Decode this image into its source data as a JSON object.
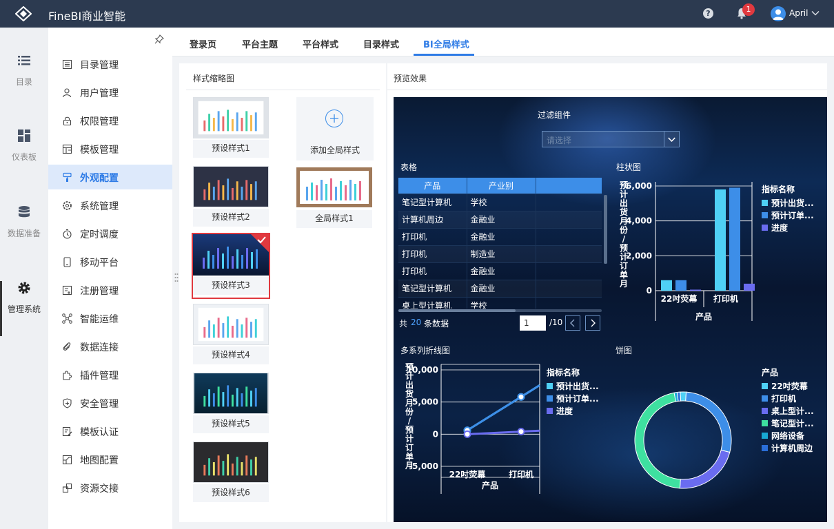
{
  "app": {
    "title": "FineBI商业智能",
    "user": "April",
    "notifications": "1",
    "help": "?"
  },
  "left_nav": [
    {
      "label": "目录",
      "icon": "list-icon"
    },
    {
      "label": "仪表板",
      "icon": "dashboard-icon"
    },
    {
      "label": "数据准备",
      "icon": "database-icon"
    },
    {
      "label": "管理系统",
      "icon": "gear-icon",
      "active": true
    }
  ],
  "side_menu": [
    {
      "label": "目录管理",
      "icon": "catalog-icon"
    },
    {
      "label": "用户管理",
      "icon": "user-icon"
    },
    {
      "label": "权限管理",
      "icon": "lock-icon"
    },
    {
      "label": "模板管理",
      "icon": "template-icon"
    },
    {
      "label": "外观配置",
      "icon": "brush-icon",
      "active": true
    },
    {
      "label": "系统管理",
      "icon": "settings-icon"
    },
    {
      "label": "定时调度",
      "icon": "timer-icon"
    },
    {
      "label": "移动平台",
      "icon": "mobile-icon"
    },
    {
      "label": "注册管理",
      "icon": "register-icon"
    },
    {
      "label": "智能运维",
      "icon": "ops-icon"
    },
    {
      "label": "数据连接",
      "icon": "link-icon"
    },
    {
      "label": "插件管理",
      "icon": "plugin-icon"
    },
    {
      "label": "安全管理",
      "icon": "shield-icon"
    },
    {
      "label": "模板认证",
      "icon": "certify-icon"
    },
    {
      "label": "地图配置",
      "icon": "map-icon"
    },
    {
      "label": "资源交接",
      "icon": "handover-icon"
    }
  ],
  "tabs": [
    {
      "label": "登录页"
    },
    {
      "label": "平台主题"
    },
    {
      "label": "平台样式"
    },
    {
      "label": "目录样式"
    },
    {
      "label": "BI全局样式",
      "active": true
    }
  ],
  "thumbnails": {
    "title": "样式缩略图",
    "add_label": "添加全局样式",
    "items": [
      {
        "label": "预设样式1"
      },
      {
        "label": "预设样式2"
      },
      {
        "label": "预设样式3",
        "selected": true
      },
      {
        "label": "预设样式4"
      },
      {
        "label": "预设样式5"
      },
      {
        "label": "预设样式6"
      },
      {
        "label": "全局样式1"
      }
    ]
  },
  "preview": {
    "title": "预览效果",
    "filter": {
      "title": "过滤组件",
      "placeholder": "请选择"
    },
    "table": {
      "title": "表格",
      "headers": [
        "产品",
        "产业别"
      ],
      "rows": [
        [
          "笔记型计算机",
          "学校"
        ],
        [
          "计算机周边",
          "金融业"
        ],
        [
          "打印机",
          "金融业"
        ],
        [
          "打印机",
          "制造业"
        ],
        [
          "打印机",
          "金融业"
        ],
        [
          "笔记型计算机",
          "金融业"
        ],
        [
          "桌上型计算机",
          "学校"
        ]
      ],
      "pager": {
        "prefix": "共",
        "count": "20",
        "suffix": "条数据",
        "page": "1",
        "total": "/10"
      }
    },
    "colors": {
      "cyan": "#4fd0f5",
      "blue": "#3d8ee8",
      "indigo": "#6a6cf0",
      "green": "#3ee0a0",
      "teal": "#18a9d4",
      "royal": "#2a6ed8"
    }
  },
  "chart_data": [
    {
      "type": "bar",
      "title": "柱状图",
      "xlabel": "产品",
      "ylabel": "预计出货月份/预计订单月份",
      "categories": [
        "22吋荧幕",
        "打印机"
      ],
      "legend_title": "指标名称",
      "legend_position": "right",
      "ylim": [
        0,
        6000
      ],
      "ticks": [
        "6,000",
        "4,000",
        "2,000",
        "0"
      ],
      "series": [
        {
          "name": "预计出货...",
          "color": "#4fd0f5",
          "values": [
            600,
            5800
          ]
        },
        {
          "name": "预计订单...",
          "color": "#3d8ee8",
          "values": [
            600,
            5900
          ]
        },
        {
          "name": "进度",
          "color": "#6a6cf0",
          "values": [
            20,
            400
          ]
        }
      ]
    },
    {
      "type": "line",
      "title": "多系列折线图",
      "xlabel": "产品",
      "ylabel": "预计出货月份/预计订单月份",
      "categories": [
        "22吋荧幕",
        "打印机"
      ],
      "legend_title": "指标名称",
      "legend_position": "right",
      "ylim": [
        -5000,
        10000
      ],
      "ticks": [
        "10,000",
        "5,000",
        "0",
        "-5,000"
      ],
      "series": [
        {
          "name": "预计出货...",
          "color": "#4fd0f5",
          "values": [
            600,
            5800
          ]
        },
        {
          "name": "预计订单...",
          "color": "#3d8ee8",
          "values": [
            600,
            5800
          ]
        },
        {
          "name": "进度",
          "color": "#6a6cf0",
          "values": [
            0,
            400
          ]
        }
      ]
    },
    {
      "type": "pie",
      "title": "饼图",
      "legend_title": "产品",
      "legend_position": "right",
      "slices": [
        {
          "name": "22吋荧幕",
          "color": "#4fd0f5",
          "value": 2
        },
        {
          "name": "打印机",
          "color": "#3d8ee8",
          "value": 28
        },
        {
          "name": "桌上型计...",
          "color": "#6a6cf0",
          "value": 22
        },
        {
          "name": "笔记型计...",
          "color": "#3ee0a0",
          "value": 46
        },
        {
          "name": "网络设备",
          "color": "#18a9d4",
          "value": 1
        },
        {
          "name": "计算机周边",
          "color": "#2a6ed8",
          "value": 1
        }
      ]
    }
  ]
}
